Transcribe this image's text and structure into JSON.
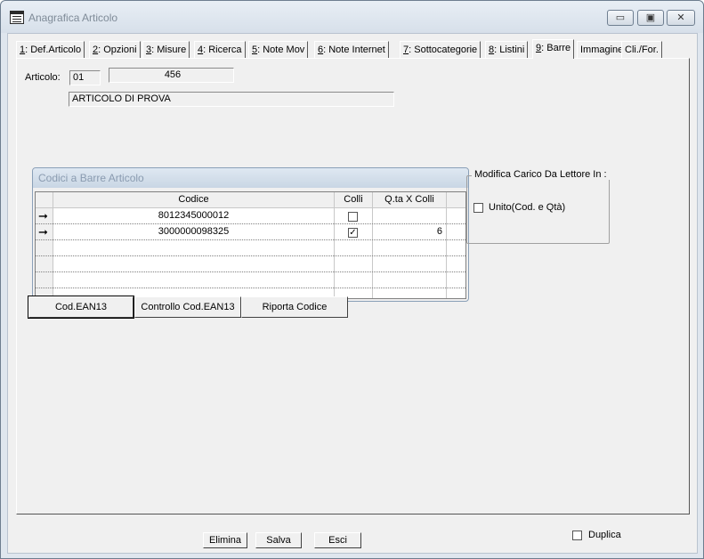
{
  "window": {
    "title": "Anagrafica Articolo",
    "minimize_glyph": "▭",
    "maximize_glyph": "▣",
    "close_glyph": "✕"
  },
  "tabs": [
    {
      "key": "1",
      "label": ": Def.Articolo"
    },
    {
      "key": "2",
      "label": ": Opzioni"
    },
    {
      "key": "3",
      "label": ": Misure"
    },
    {
      "key": "4",
      "label": ": Ricerca"
    },
    {
      "key": "5",
      "label": ": Note Mov"
    },
    {
      "key": "6",
      "label": ": Note Internet"
    },
    {
      "key": "7",
      "label": ": Sottocategorie"
    },
    {
      "key": "8",
      "label": ": Listini"
    },
    {
      "key": "9",
      "label": ": Barre"
    },
    {
      "key": "",
      "label": "Immagine"
    },
    {
      "key": "",
      "label": "Cli./For."
    }
  ],
  "article": {
    "label": "Articolo:",
    "code1": "01",
    "code2": "456",
    "description": "ARTICOLO DI PROVA"
  },
  "barcodes": {
    "caption": "Codici a Barre Articolo",
    "columns": [
      "Codice",
      "Colli",
      "Q.ta X Colli"
    ],
    "rows": [
      {
        "codice": "8012345000012",
        "colli": false,
        "qta": ""
      },
      {
        "codice": "3000000098325",
        "colli": true,
        "qta": "6"
      }
    ],
    "row_indicator": "➞"
  },
  "reader_group": {
    "title": "Modifica Carico Da Lettore In :",
    "unito_label": "Unito(Cod. e Qtà)",
    "unito_checked": false
  },
  "buttons": {
    "ean13": "Cod.EAN13",
    "controllo": "Controllo Cod.EAN13",
    "riporta": "Riporta Codice"
  },
  "bottom": {
    "elimina": "Elimina",
    "salva": "Salva",
    "esci": "Esci",
    "duplica_label": "Duplica",
    "duplica_checked": false
  }
}
